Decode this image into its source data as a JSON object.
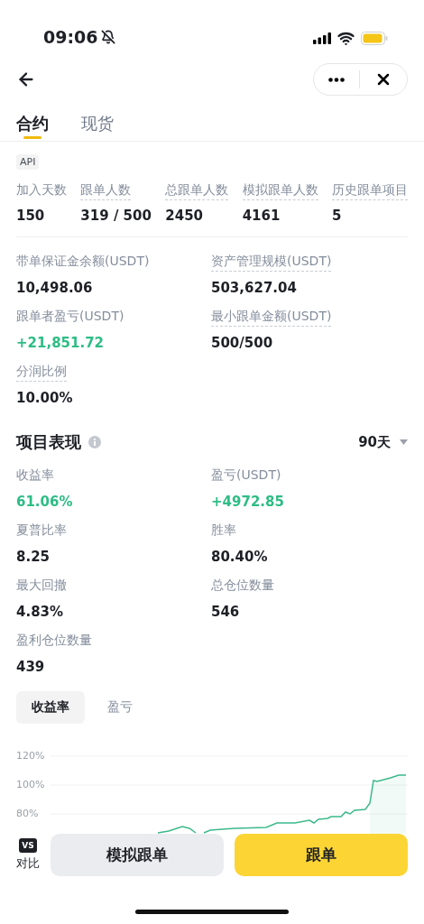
{
  "status_bar": {
    "time": "09:06",
    "muted": true
  },
  "tabs": [
    {
      "label": "合约",
      "selected": true
    },
    {
      "label": "现货",
      "selected": false
    }
  ],
  "tag": "API",
  "stats": [
    {
      "label": "加入天数",
      "value": "150",
      "hint": false
    },
    {
      "label": "跟单人数",
      "value": "319 / 500",
      "hint": true
    },
    {
      "label": "总跟单人数",
      "value": "2450",
      "hint": true
    },
    {
      "label": "模拟跟单人数",
      "value": "4161",
      "hint": true
    },
    {
      "label": "历史跟单项目",
      "value": "5",
      "hint": true
    }
  ],
  "info": [
    {
      "label": "带单保证金余额(USDT)",
      "value": "10,498.06",
      "hint": false,
      "color": "#1e2026"
    },
    {
      "label": "资产管理规模(USDT)",
      "value": "503,627.04",
      "hint": true,
      "color": "#1e2026"
    },
    {
      "label": "跟单者盈亏(USDT)",
      "value": "+21,851.72",
      "hint": false,
      "color": "#2ebd85"
    },
    {
      "label": "最小跟单金额(USDT)",
      "value": "500/500",
      "hint": true,
      "color": "#1e2026"
    },
    {
      "label": "分润比例",
      "value": "10.00%",
      "hint": true,
      "color": "#1e2026"
    }
  ],
  "performance": {
    "title": "项目表现",
    "period": "90天",
    "metrics": [
      {
        "label": "收益率",
        "value": "61.06%",
        "color": "#2ebd85"
      },
      {
        "label": "盈亏(USDT)",
        "value": "+4972.85",
        "color": "#2ebd85"
      },
      {
        "label": "夏普比率",
        "value": "8.25",
        "color": "#1e2026"
      },
      {
        "label": "胜率",
        "value": "80.40%",
        "color": "#1e2026"
      },
      {
        "label": "最大回撤",
        "value": "4.83%",
        "color": "#1e2026"
      },
      {
        "label": "总仓位数量",
        "value": "546",
        "color": "#1e2026"
      },
      {
        "label": "盈利仓位数量",
        "value": "439",
        "color": "#1e2026"
      }
    ],
    "chart_tabs": [
      {
        "label": "收益率",
        "selected": true
      },
      {
        "label": "盈亏",
        "selected": false
      }
    ],
    "chart": {
      "axis_labels": [
        "120%",
        "100%",
        "80%"
      ]
    }
  },
  "bottom_bar": {
    "compare_badge": "VS",
    "compare_label": "对比",
    "buttons": [
      {
        "label": "模拟跟单",
        "kind": "secondary"
      },
      {
        "label": "跟单",
        "kind": "primary"
      }
    ]
  }
}
